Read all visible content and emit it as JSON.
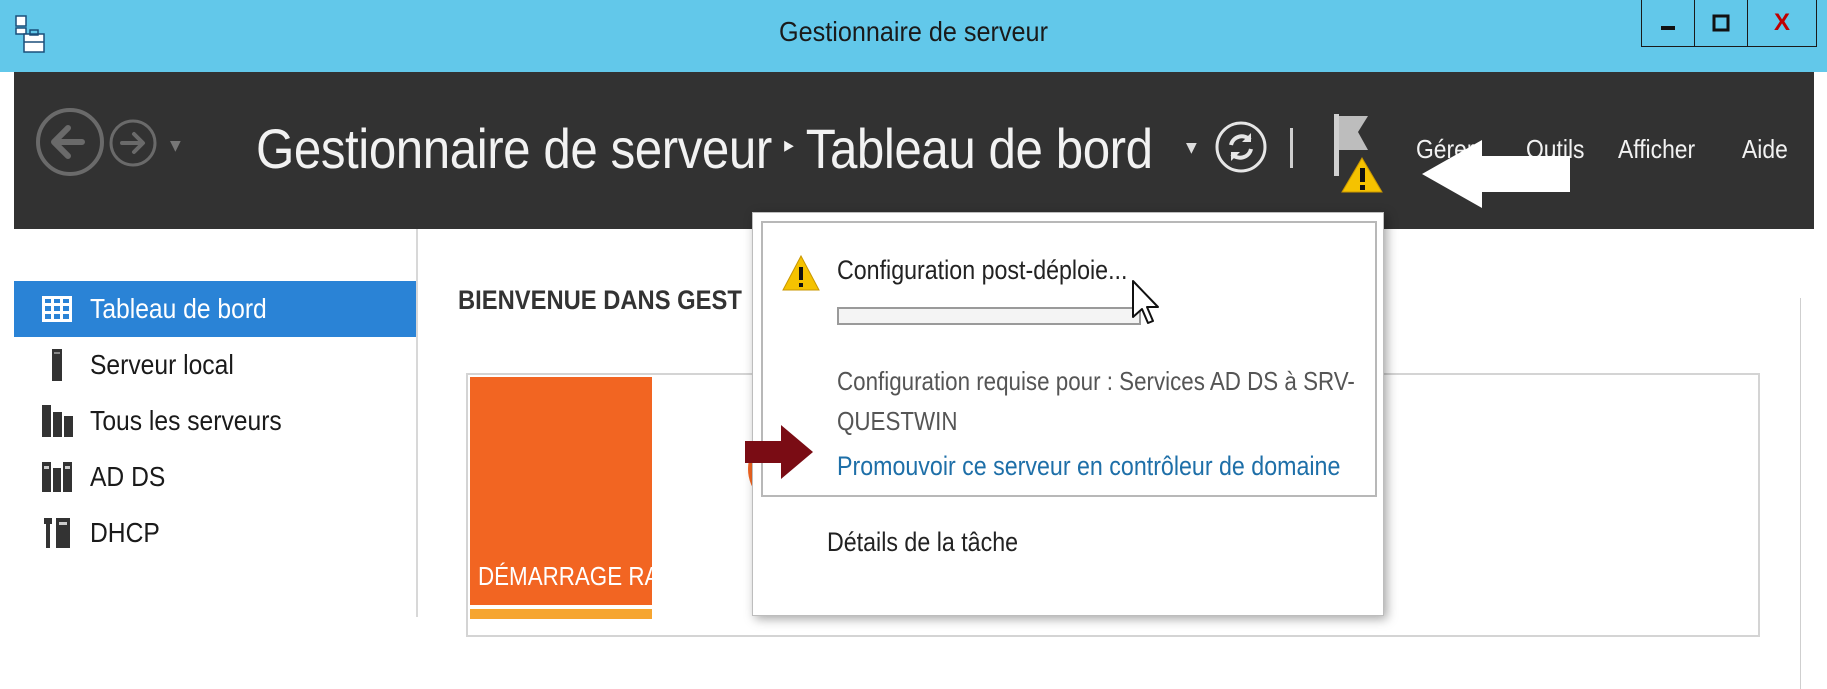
{
  "window": {
    "title": "Gestionnaire de serveur",
    "minimize_label": "▁",
    "maximize_label": "☐",
    "close_label": "X"
  },
  "header": {
    "breadcrumb_root": "Gestionnaire de serveur",
    "breadcrumb_separator": "▸",
    "breadcrumb_current": "Tableau de bord",
    "menu": [
      "Gérer",
      "Outils",
      "Afficher",
      "Aide"
    ]
  },
  "sidebar": {
    "items": [
      {
        "label": "Tableau de bord",
        "icon": "dashboard-icon",
        "active": true
      },
      {
        "label": "Serveur local",
        "icon": "local-server-icon",
        "active": false
      },
      {
        "label": "Tous les serveurs",
        "icon": "all-servers-icon",
        "active": false
      },
      {
        "label": "AD DS",
        "icon": "ad-ds-icon",
        "active": false
      },
      {
        "label": "DHCP",
        "icon": "dhcp-icon",
        "active": false
      }
    ]
  },
  "main": {
    "welcome_title": "BIENVENUE DANS GEST",
    "quickstart_tile": "DÉMARRAGE RAPIDE"
  },
  "notification": {
    "title": "Configuration post-déploie...",
    "description": "Configuration requise pour : Services AD DS à SRV-QUESTWIN",
    "link": "Promouvoir ce serveur en contrôleur de domaine",
    "task_details": "Détails de la tâche",
    "progress": 0
  },
  "colors": {
    "titlebar": "#62c8ea",
    "header": "#323232",
    "active_nav": "#2a83d6",
    "quickstart": "#f26522",
    "link": "#1e6fa8",
    "warning": "#f5c200",
    "annotation_arrow": "#7a0c14"
  }
}
